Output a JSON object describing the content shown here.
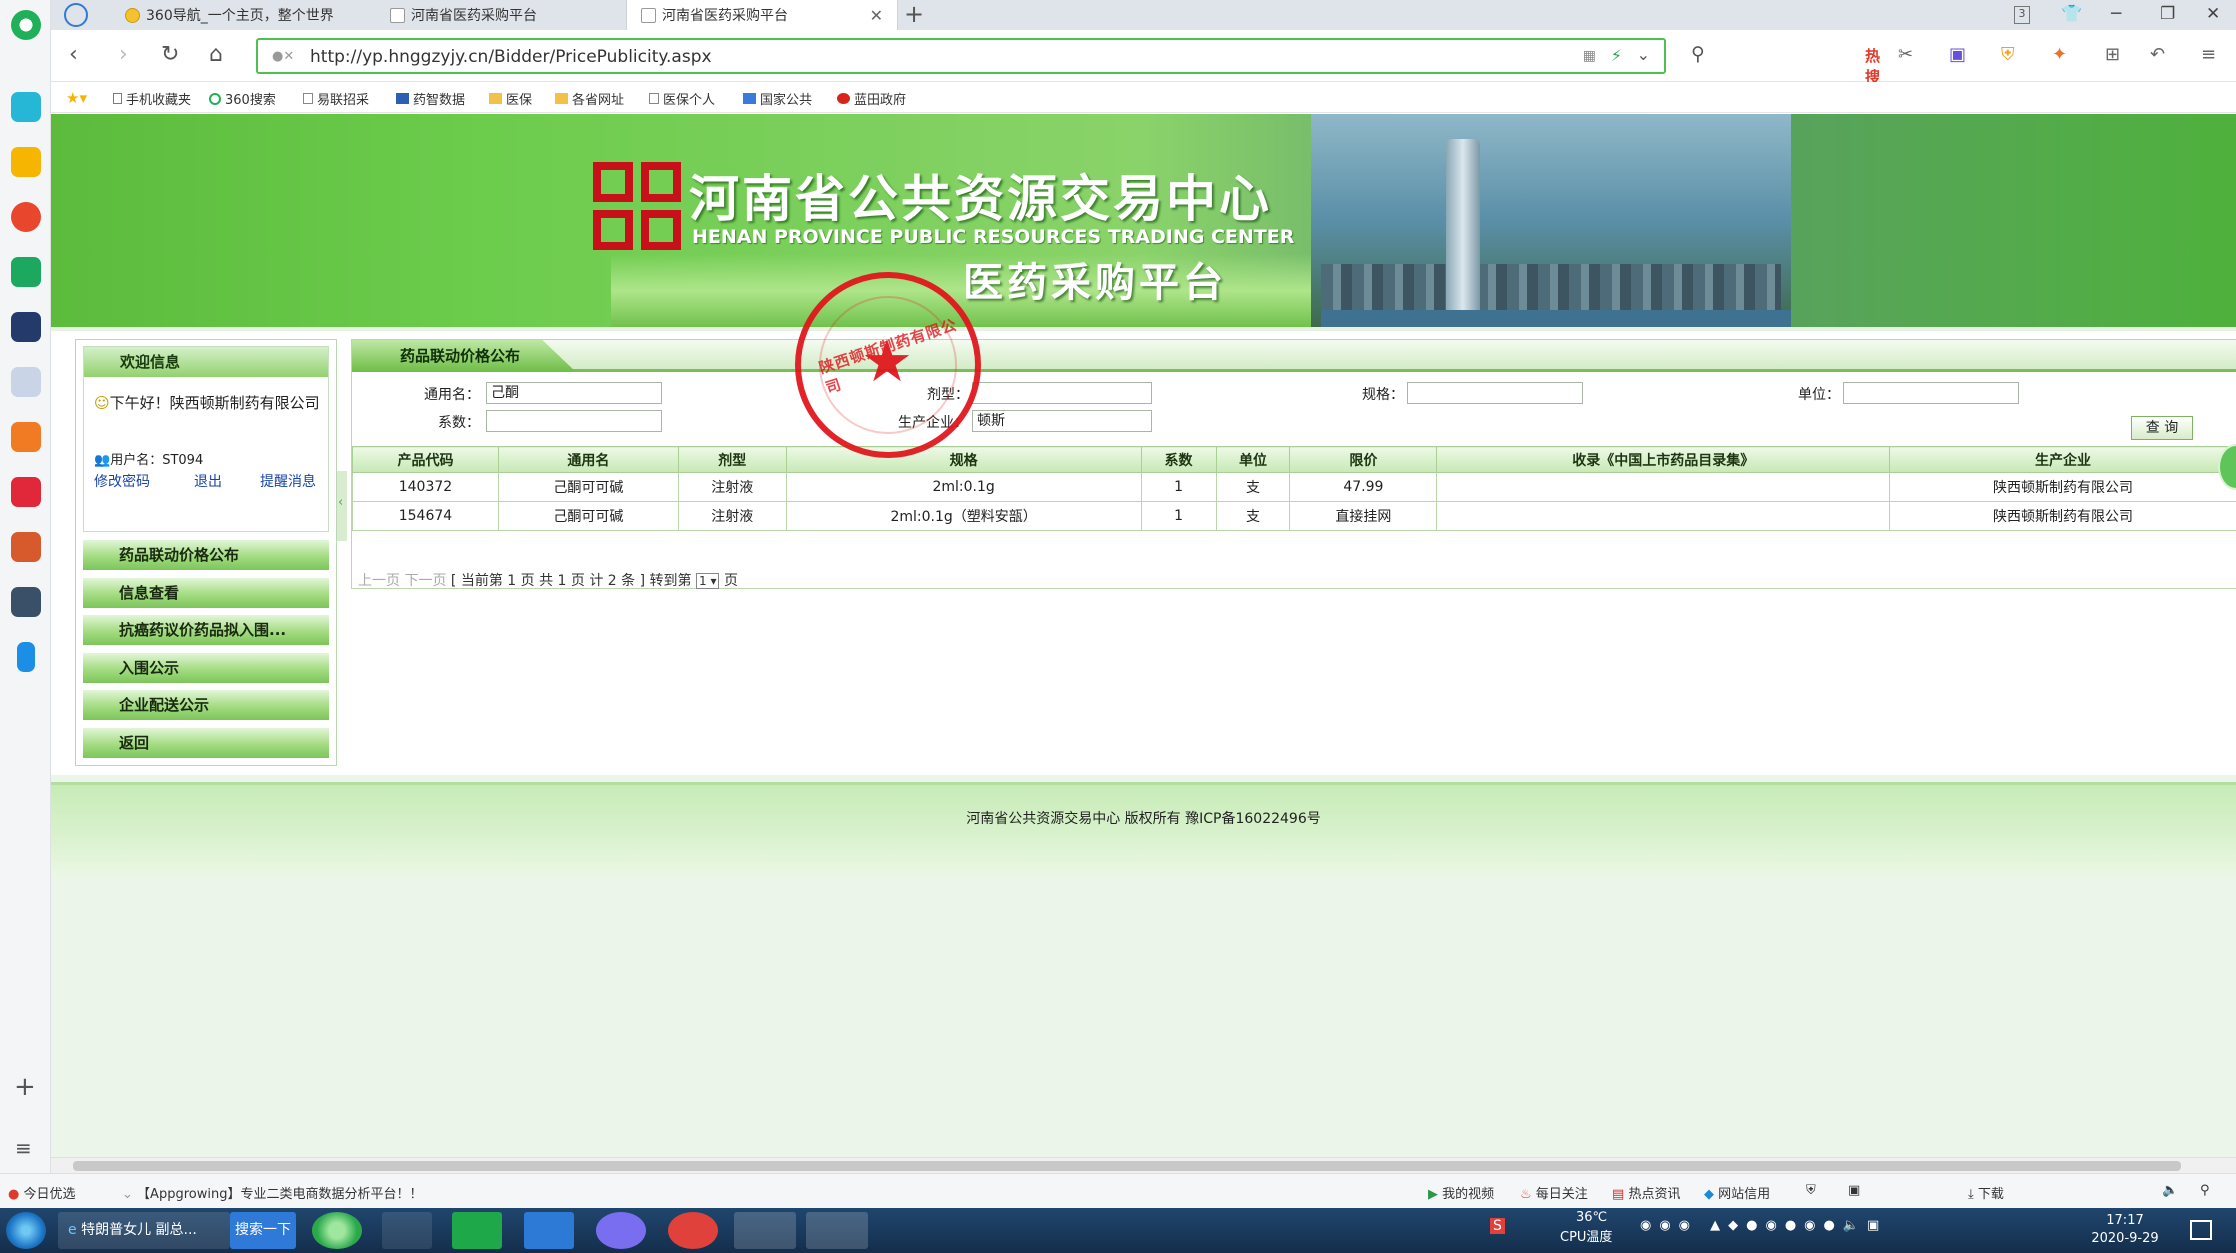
{
  "browser": {
    "tabs": [
      {
        "label": "360导航_一个主页，整个世界"
      },
      {
        "label": "河南省医药采购平台"
      },
      {
        "label": "河南省医药采购平台"
      }
    ],
    "tab_count_badge": "3",
    "url": "http://yp.hnggzyjy.cn/Bidder/PricePublicity.aspx",
    "hot_search": "热搜",
    "bookmarks": [
      "手机收藏夹",
      "360搜索",
      "易联招采",
      "药智数据",
      "医保",
      "各省网址",
      "医保个人",
      "国家公共",
      "蓝田政府"
    ]
  },
  "banner": {
    "title_cn": "河南省公共资源交易中心",
    "title_en": "HENAN PROVINCE PUBLIC RESOURCES TRADING CENTER",
    "subtitle": "医药采购平台"
  },
  "sidebar": {
    "welcome_header": "欢迎信息",
    "greeting": "下午好！陕西顿斯制药有限公司",
    "username_label": "用户名：",
    "username": "ST094",
    "links": {
      "change_password": "修改密码",
      "logout": "退出",
      "reminder": "提醒消息"
    },
    "menu": [
      "药品联动价格公布",
      "信息查看",
      "抗癌药议价药品拟入围...",
      "入围公示",
      "企业配送公示",
      "返回"
    ]
  },
  "main": {
    "tab_title": "药品联动价格公布",
    "filters": {
      "generic_label": "通用名：",
      "generic_value": "己酮",
      "dosage_label": "剂型：",
      "dosage_value": "",
      "spec_label": "规格：",
      "spec_value": "",
      "unit_label": "单位：",
      "unit_value": "",
      "coef_label": "系数：",
      "coef_value": "",
      "mfr_label": "生产企业：",
      "mfr_value": "顿斯"
    },
    "query_button": "查 询",
    "table": {
      "headers": [
        "产品代码",
        "通用名",
        "剂型",
        "规格",
        "系数",
        "单位",
        "限价",
        "收录《中国上市药品目录集》",
        "生产企业"
      ],
      "rows": [
        [
          "140372",
          "己酮可可碱",
          "注射液",
          "2ml:0.1g",
          "1",
          "支",
          "47.99",
          "",
          "陕西顿斯制药有限公司"
        ],
        [
          "154674",
          "己酮可可碱",
          "注射液",
          "2ml:0.1g（塑料安瓿）",
          "1",
          "支",
          "直接挂网",
          "",
          "陕西顿斯制药有限公司"
        ]
      ]
    },
    "pager": {
      "prev": "上一页",
      "next": "下一页",
      "current": "[ 当前第 1 页",
      "total_pages": "共 1 页",
      "total_records": "计 2 条 ]",
      "goto_label": "转到第",
      "goto_value": "1",
      "goto_suffix": "页"
    },
    "stamp_text": "陕西顿斯制药有限公司"
  },
  "footer": {
    "text": "河南省公共资源交易中心 版权所有 豫ICP备16022496号"
  },
  "statusbar": {
    "left1": "今日优选",
    "ad": "【Appgrowing】专业二类电商数据分析平台！！",
    "items": [
      "我的视频",
      "每日关注",
      "热点资讯",
      "网站信用",
      "下载"
    ]
  },
  "taskbar": {
    "ie_item": "特朗普女儿 副总...",
    "search_button": "搜索一下",
    "temperature": "36℃",
    "cpu_label": "CPU温度",
    "time": "17:17",
    "date": "2020-9-29"
  },
  "colors": {
    "accent_green": "#4cc24c",
    "banner_green": "#5cbb3c",
    "stamp_red": "#e0141a",
    "link_blue": "#1a45a8"
  }
}
